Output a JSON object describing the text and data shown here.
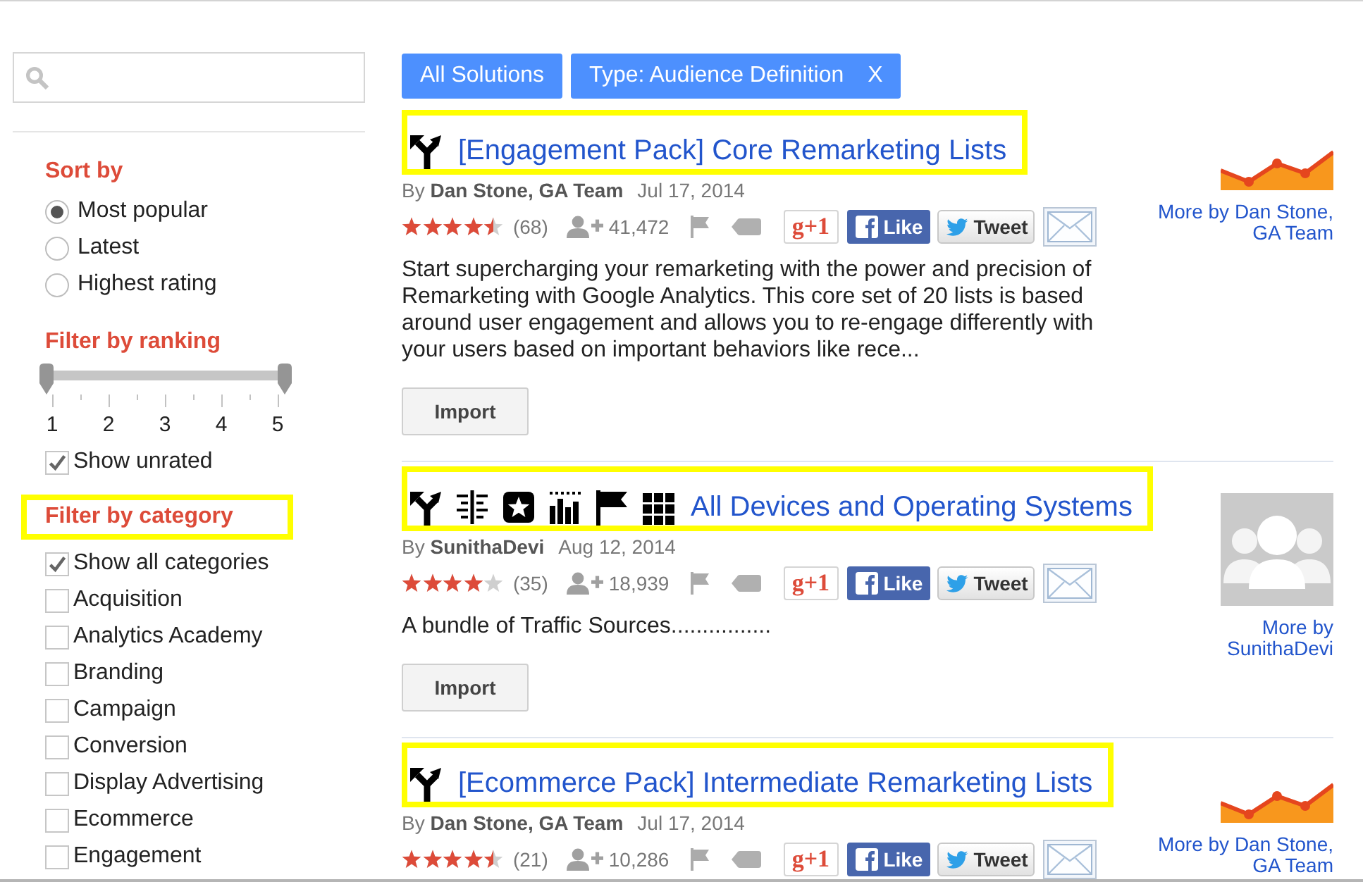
{
  "sort": {
    "title": "Sort by",
    "options": [
      {
        "label": "Most popular",
        "selected": true
      },
      {
        "label": "Latest",
        "selected": false
      },
      {
        "label": "Highest rating",
        "selected": false
      }
    ]
  },
  "ranking": {
    "title": "Filter by ranking",
    "thumbs": [
      {
        "level": 0
      },
      {
        "level": 1
      }
    ],
    "ticks": [
      "1",
      "2",
      "3",
      "4",
      "5"
    ],
    "show_unrated": {
      "label": "Show unrated",
      "checked": true
    }
  },
  "categories": {
    "title": "Filter by category",
    "highlighted": true,
    "options": [
      {
        "label": "Show all categories",
        "checked": true
      },
      {
        "label": "Acquisition",
        "checked": false
      },
      {
        "label": "Analytics Academy",
        "checked": false
      },
      {
        "label": "Branding",
        "checked": false
      },
      {
        "label": "Campaign",
        "checked": false
      },
      {
        "label": "Conversion",
        "checked": false
      },
      {
        "label": "Display Advertising",
        "checked": false
      },
      {
        "label": "Ecommerce",
        "checked": false
      },
      {
        "label": "Engagement",
        "checked": false
      }
    ]
  },
  "filters": [
    {
      "label": "All Solutions"
    },
    {
      "label": "Type: Audience Definition",
      "remove": "X"
    }
  ],
  "solutions": [
    {
      "highlighted": true,
      "type_icons": [
        {
          "kind": "fork"
        }
      ],
      "title": "[Engagement Pack] Core Remarketing Lists",
      "byline": "By **Dan Stone, GA Team**",
      "date": "Jul 17, 2014",
      "stars": 4.5,
      "rating_count": "(68)",
      "imports": "41,472",
      "share_buttons": [
        {
          "kind": "gplus",
          "label": "g+1"
        },
        {
          "kind": "facebook",
          "label": "Like"
        },
        {
          "kind": "twitter",
          "label": "Tweet"
        },
        {
          "kind": "email"
        }
      ],
      "description": "Start supercharging your remarketing with the power and precision of Remarketing with Google Analytics. This core set of 20 lists is based around user engagement and allows you to re-engage differently with your users based on important behaviors like rece...",
      "action": "Import",
      "thumbnail": {
        "kind": "chart"
      },
      "more_by": "More by Dan Stone, GA Team"
    },
    {
      "highlighted": true,
      "type_icons": [
        {
          "kind": "fork"
        },
        {
          "kind": "lines"
        },
        {
          "kind": "star-tile"
        },
        {
          "kind": "bars"
        },
        {
          "kind": "flag"
        },
        {
          "kind": "grid"
        }
      ],
      "title": "All Devices and Operating Systems",
      "byline": "By **SunithaDevi**",
      "date": "Aug 12, 2014",
      "stars": 4,
      "rating_count": "(35)",
      "imports": "18,939",
      "share_buttons": [
        {
          "kind": "gplus",
          "label": "g+1"
        },
        {
          "kind": "facebook",
          "label": "Like"
        },
        {
          "kind": "twitter",
          "label": "Tweet"
        },
        {
          "kind": "email"
        }
      ],
      "description": "A bundle of Traffic Sources................",
      "action": "Import",
      "thumbnail": {
        "kind": "avatar"
      },
      "more_by": "More by SunithaDevi"
    },
    {
      "highlighted": true,
      "type_icons": [
        {
          "kind": "fork"
        }
      ],
      "title": "[Ecommerce Pack] Intermediate Remarketing Lists",
      "byline": "By **Dan Stone, GA Team**",
      "date": "Jul 17, 2014",
      "stars": 4.5,
      "rating_count": "(21)",
      "imports": "10,286",
      "share_buttons": [
        {
          "kind": "gplus",
          "label": "g+1"
        },
        {
          "kind": "facebook",
          "label": "Like"
        },
        {
          "kind": "twitter",
          "label": "Tweet"
        },
        {
          "kind": "email"
        }
      ],
      "thumbnail": {
        "kind": "chart"
      },
      "more_by": "More by Dan Stone, GA Team"
    }
  ]
}
